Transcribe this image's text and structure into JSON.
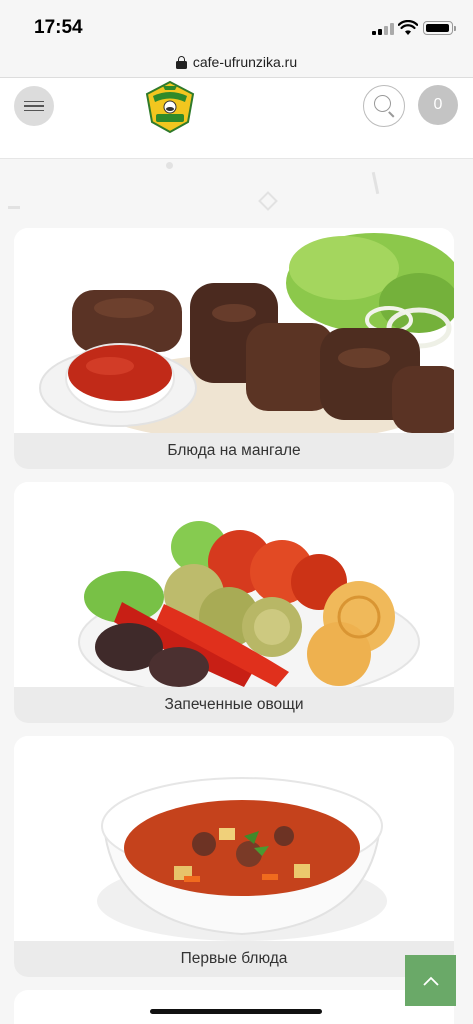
{
  "status_bar": {
    "time": "17:54"
  },
  "browser": {
    "url": "cafe-ufrunzika.ru"
  },
  "header": {
    "menu_icon": "hamburger-icon",
    "logo_icon": "cafe-logo",
    "search_icon": "search-icon",
    "cart_count": "0"
  },
  "categories": [
    {
      "label": "Блюда на мангале",
      "image": "grilled-kebab-photo"
    },
    {
      "label": "Запеченные овощи",
      "image": "grilled-vegetables-photo"
    },
    {
      "label": "Первые блюда",
      "image": "soup-bowl-photo"
    }
  ],
  "scroll_top": {
    "icon": "chevron-up-icon"
  },
  "colors": {
    "accent_green": "#6aa968",
    "card_label_bg": "#ebebeb",
    "page_bg": "#f6f6f6"
  }
}
